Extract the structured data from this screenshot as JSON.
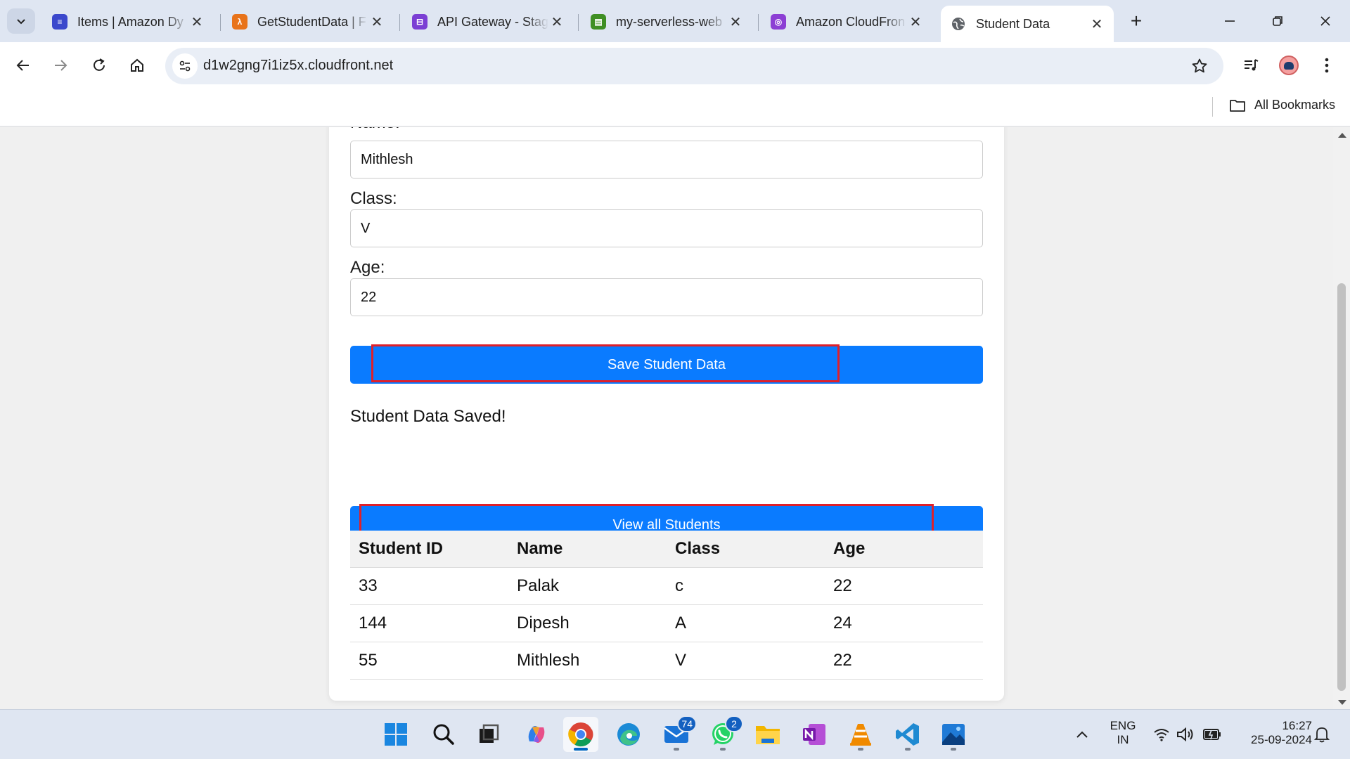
{
  "browser": {
    "tabs": [
      {
        "title": "Items | Amazon Dy",
        "favicon_color": "#3b48cc"
      },
      {
        "title": "GetStudentData | F",
        "favicon_color": "#e8731a"
      },
      {
        "title": "API Gateway - Stag",
        "favicon_color": "#7b3fd4"
      },
      {
        "title": "my-serverless-web",
        "favicon_color": "#3f8f24"
      },
      {
        "title": "Amazon CloudFron",
        "favicon_color": "#8c3fd4"
      },
      {
        "title": "Student Data",
        "favicon_color": "#5f6368"
      }
    ],
    "url": "d1w2gng7i1iz5x.cloudfront.net",
    "all_bookmarks_label": "All Bookmarks"
  },
  "form": {
    "name_label": "Name:",
    "name_value": "Mithlesh",
    "class_label": "Class:",
    "class_value": "V",
    "age_label": "Age:",
    "age_value": "22",
    "save_button_label": "Save Student Data",
    "status_message": "Student Data Saved!",
    "view_button_label": "View all Students"
  },
  "students_table": {
    "headers": [
      "Student ID",
      "Name",
      "Class",
      "Age"
    ],
    "rows": [
      [
        "33",
        "Palak",
        "c",
        "22"
      ],
      [
        "144",
        "Dipesh",
        "A",
        "24"
      ],
      [
        "55",
        "Mithlesh",
        "V",
        "22"
      ]
    ]
  },
  "taskbar": {
    "apps": [
      "windows-start",
      "search",
      "task-view",
      "copilot",
      "chrome",
      "edge",
      "mail",
      "whatsapp",
      "file-explorer",
      "onenote",
      "vlc",
      "vscode",
      "photos"
    ],
    "mail_badge": "74",
    "whatsapp_badge": "2",
    "language_line1": "ENG",
    "language_line2": "IN",
    "time": "16:27",
    "date": "25-09-2024"
  },
  "colors": {
    "accent_button": "#0a7bff",
    "highlight_box": "#e0202a"
  }
}
